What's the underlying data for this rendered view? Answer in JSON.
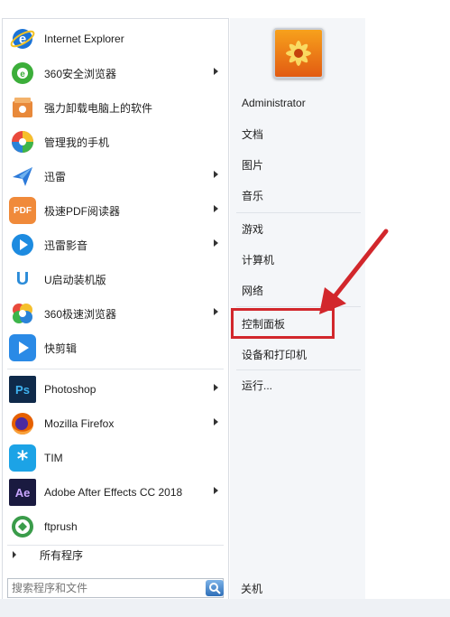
{
  "programs": [
    {
      "label": "Internet Explorer",
      "has_submenu": false,
      "icon": "internet-explorer-icon",
      "color": "#1a73d6"
    },
    {
      "label": "360安全浏览器",
      "has_submenu": true,
      "icon": "360-safe-browser-icon",
      "color": "#3cae3a"
    },
    {
      "label": "强力卸载电脑上的软件",
      "has_submenu": false,
      "icon": "uninstaller-icon",
      "color": "#e8893a"
    },
    {
      "label": "管理我的手机",
      "has_submenu": false,
      "icon": "phone-manager-icon",
      "color": "#e94a3c"
    },
    {
      "label": "迅雷",
      "has_submenu": true,
      "icon": "xunlei-icon",
      "color": "#2b79d9"
    },
    {
      "label": "极速PDF阅读器",
      "has_submenu": true,
      "icon": "pdf-reader-icon",
      "color": "#f08a3a"
    },
    {
      "label": "迅雷影音",
      "has_submenu": true,
      "icon": "xunlei-video-icon",
      "color": "#1d8be0"
    },
    {
      "label": "U启动装机版",
      "has_submenu": false,
      "icon": "u-boot-icon",
      "color": "#2a8bd8"
    },
    {
      "label": "360极速浏览器",
      "has_submenu": true,
      "icon": "360-speed-browser-icon",
      "color": "#5bb33c"
    },
    {
      "label": "快剪辑",
      "has_submenu": false,
      "icon": "video-editor-icon",
      "color": "#2a8ae6"
    },
    {
      "label": "Photoshop",
      "has_submenu": true,
      "icon": "photoshop-icon",
      "color": "#0f2a4a"
    },
    {
      "label": "Mozilla Firefox",
      "has_submenu": true,
      "icon": "firefox-icon",
      "color": "#e66000"
    },
    {
      "label": "TIM",
      "has_submenu": false,
      "icon": "tim-icon",
      "color": "#1ca3e6"
    },
    {
      "label": "Adobe After Effects CC 2018",
      "has_submenu": true,
      "icon": "after-effects-icon",
      "color": "#1a1a40"
    },
    {
      "label": "ftprush",
      "has_submenu": false,
      "icon": "ftprush-icon",
      "color": "#3a9c4a"
    }
  ],
  "all_programs": "所有程序",
  "search": {
    "placeholder": "搜索程序和文件"
  },
  "shutdown": "关机",
  "user": {
    "name": "Administrator"
  },
  "places": {
    "documents": "文档",
    "pictures": "图片",
    "music": "音乐",
    "games": "游戏",
    "computer": "计算机",
    "network": "网络",
    "control_panel": "控制面板",
    "devices_printers": "设备和打印机",
    "run": "运行..."
  },
  "icons": {
    "photoshop": "Ps",
    "after_effects": "Ae",
    "pdf": "PDF",
    "u_boot": "U"
  },
  "colors": {
    "highlight": "#d2272c",
    "arrow": "#d2272c"
  }
}
